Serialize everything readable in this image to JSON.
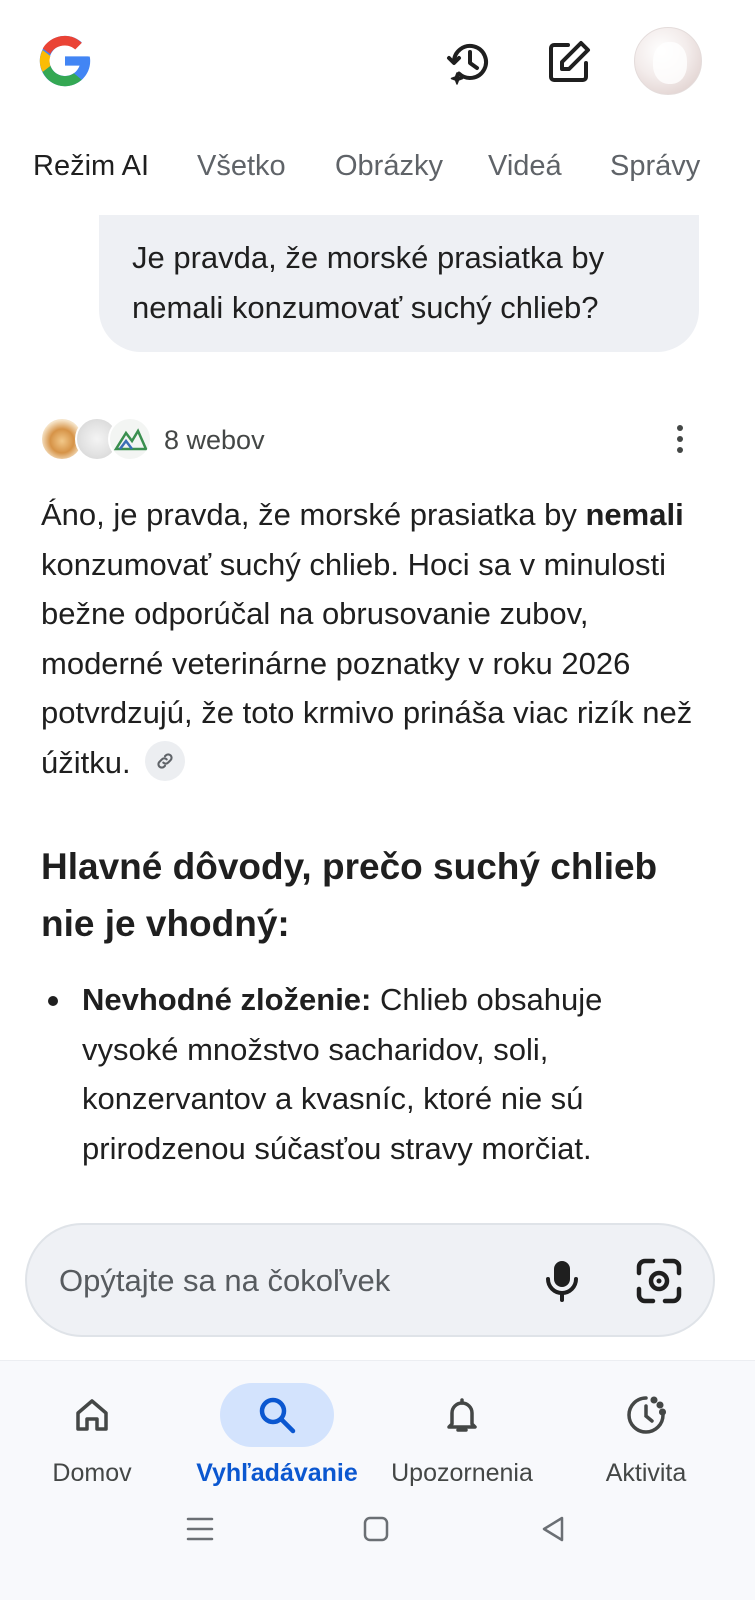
{
  "colors": {
    "accent": "#0b57d0",
    "active_pill": "#d3e3fd",
    "bubble_bg": "#eef0f4",
    "text": "#1f1f1f",
    "muted": "#5f6368"
  },
  "header": {
    "logo": "google-g-logo",
    "icons": [
      "history-sparkle-icon",
      "edit-icon",
      "avatar"
    ]
  },
  "tabs": [
    {
      "label": "Režim AI",
      "active": true
    },
    {
      "label": "Všetko"
    },
    {
      "label": "Obrázky"
    },
    {
      "label": "Videá"
    },
    {
      "label": "Správy"
    }
  ],
  "query": {
    "text": "Je pravda, že morské prasiatka by nemali konzumovať suchý chlieb?"
  },
  "sources": {
    "label": "8 webov"
  },
  "answer": {
    "part1": "Áno, je pravda, že morské prasiatka by ",
    "bold": "nemali",
    "part2": " konzumovať suchý chlieb. Hoci sa v minulosti bežne odporúčal na obrusovanie zubov, moderné veterinárne poznatky v roku 2026 potvrdzujú, že toto krmivo prináša viac rizík než úžitku."
  },
  "section": {
    "heading": "Hlavné dôvody, prečo suchý chlieb nie je vhodný:",
    "bullets": [
      {
        "title": "Nevhodné zloženie:",
        "text": " Chlieb obsahuje vysoké množstvo sacharidov, soli, konzervantov a kvasníc, ktoré nie sú prirodzenou súčasťou stravy morčiat."
      }
    ]
  },
  "search": {
    "placeholder": "Opýtajte sa na čokoľvek"
  },
  "bottom_nav": [
    {
      "label": "Domov",
      "icon": "home-icon"
    },
    {
      "label": "Vyhľadávanie",
      "icon": "search-icon",
      "active": true
    },
    {
      "label": "Upozornenia",
      "icon": "bell-icon"
    },
    {
      "label": "Aktivita",
      "icon": "activity-icon"
    }
  ]
}
